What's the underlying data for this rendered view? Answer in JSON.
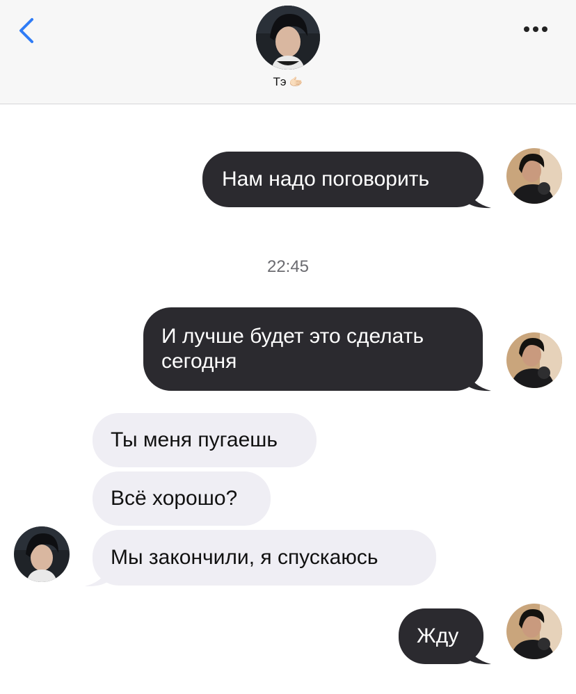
{
  "header": {
    "back_icon": "chevron-left-icon",
    "more_icon": "ellipsis-icon",
    "contact_name": "Тэ",
    "contact_emoji": "🫱🏻",
    "accent_color": "#2f7cf6"
  },
  "messages": [
    {
      "direction": "outgoing",
      "text": "Нам надо поговорить"
    },
    {
      "direction": "outgoing",
      "text": "И лучше будет это сделать сегодня"
    },
    {
      "direction": "incoming",
      "text": "Ты меня пугаешь"
    },
    {
      "direction": "incoming",
      "text": "Всё хорошо?"
    },
    {
      "direction": "incoming",
      "text": "Мы закончили, я спускаюсь"
    },
    {
      "direction": "outgoing",
      "text": "Жду"
    }
  ],
  "timestamp": "22:45",
  "colors": {
    "outgoing_bubble": "#2b2a2f",
    "incoming_bubble": "#efeef4",
    "header_bg": "#f7f7f7"
  }
}
